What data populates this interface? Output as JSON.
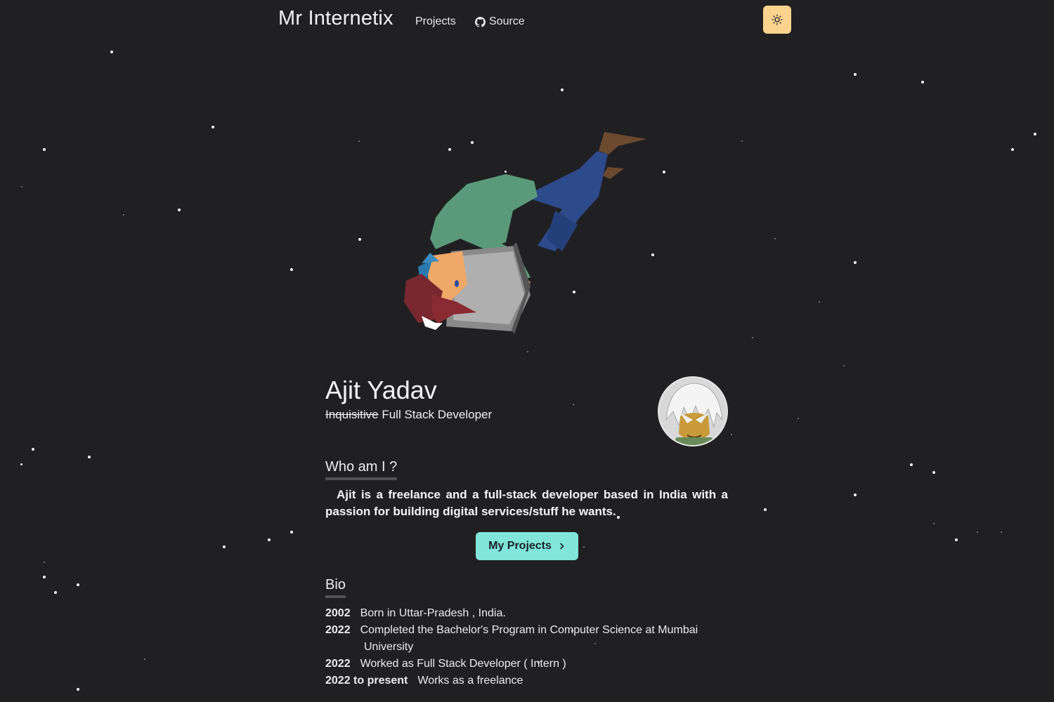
{
  "nav": {
    "brand": "Mr Internetix",
    "projects_label": "Projects",
    "source_label": "Source",
    "theme_toggle_icon": "sun-icon",
    "theme_toggle_color": "#fbd38d"
  },
  "intro": {
    "name": "Ajit Yadav",
    "tagline_struck": "Inquisitive",
    "tagline_rest": " Full Stack Developer"
  },
  "about": {
    "title": "Who am I ?",
    "text": "Ajit is a freelance and a full-stack developer based in India with a passion for building digital services/stuff he wants.",
    "cta_label": "My Projects",
    "cta_color": "#81e6d9"
  },
  "bio": {
    "title": "Bio",
    "entries": [
      {
        "year": "2002",
        "text": "Born in Uttar-Pradesh , India."
      },
      {
        "year": "2022",
        "text": "Completed the Bachelor's Program in Computer Science at Mumbai",
        "text_cont": "University"
      },
      {
        "year": "2022",
        "text": "Worked as Full Stack Developer ( Intern )"
      },
      {
        "year": "2022 to present",
        "text": "Works as a freelance"
      }
    ]
  },
  "colors": {
    "background": "#202023",
    "accent": "#81e6d9"
  }
}
